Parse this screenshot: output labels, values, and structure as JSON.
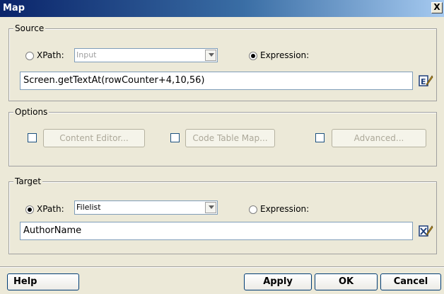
{
  "window": {
    "title": "Map",
    "close_label": "X"
  },
  "source": {
    "legend": "Source",
    "xpath_label": "XPath:",
    "xpath_value": "Input",
    "expression_label": "Expression:",
    "selected": "expression",
    "expression_value": "Screen.getTextAt(rowCounter+4,10,56)"
  },
  "options": {
    "legend": "Options",
    "content_editor_label": "Content Editor...",
    "code_table_map_label": "Code Table Map...",
    "advanced_label": "Advanced..."
  },
  "target": {
    "legend": "Target",
    "xpath_label": "XPath:",
    "xpath_value": "Filelist",
    "expression_label": "Expression:",
    "selected": "xpath",
    "field_value": "AuthorName"
  },
  "footer": {
    "help_label": "Help",
    "apply_label": "Apply",
    "ok_label": "OK",
    "cancel_label": "Cancel"
  },
  "icons": {
    "source_edit": "edit-expression-icon",
    "target_edit": "edit-xpath-icon"
  }
}
